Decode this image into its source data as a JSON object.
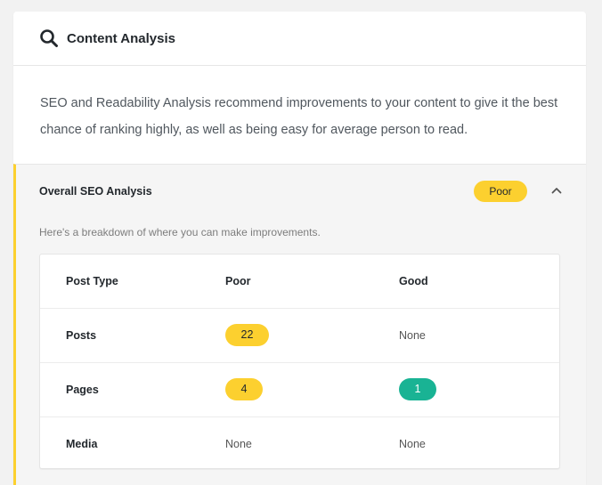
{
  "header": {
    "title": "Content Analysis",
    "icon": "search-icon"
  },
  "intro": "SEO and Readability Analysis recommend improvements to your content to give it the best chance of ranking highly, as well as being easy for average person to read.",
  "seo": {
    "title": "Overall SEO Analysis",
    "status": "Poor",
    "toggle_icon": "chevron-up-icon",
    "description": "Here's a breakdown of where you can make improvements.",
    "table": {
      "headers": [
        "Post Type",
        "Poor",
        "Good"
      ],
      "rows": [
        {
          "type": "Posts",
          "poor": "22",
          "good": "None"
        },
        {
          "type": "Pages",
          "poor": "4",
          "good": "1"
        },
        {
          "type": "Media",
          "poor": "None",
          "good": "None"
        }
      ]
    }
  },
  "colors": {
    "poor": "#fcd02f",
    "good": "#19b394",
    "accent_border": "#fcd02f"
  }
}
